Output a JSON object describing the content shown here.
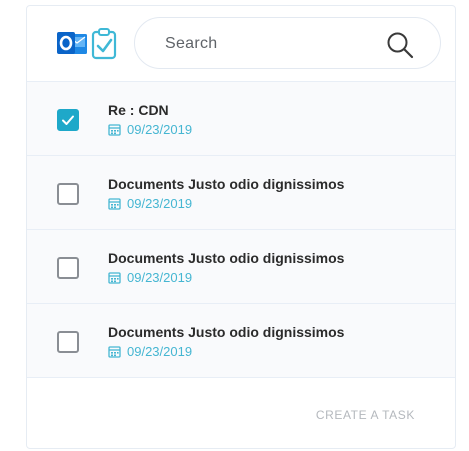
{
  "header": {
    "logo_icon": "outlook-tasks-logo-icon",
    "search": {
      "placeholder": "Search",
      "value": "",
      "icon": "search-icon"
    }
  },
  "tasks": [
    {
      "title": "Re : CDN",
      "date": "09/23/2019",
      "checked": true
    },
    {
      "title": "Documents Justo odio dignissimos",
      "date": "09/23/2019",
      "checked": false
    },
    {
      "title": "Documents Justo odio dignissimos",
      "date": "09/23/2019",
      "checked": false
    },
    {
      "title": "Documents Justo odio dignissimos",
      "date": "09/23/2019",
      "checked": false
    }
  ],
  "footer": {
    "create_task_label": "CREATE A TASK"
  },
  "colors": {
    "accent": "#1ea8c9",
    "date_text": "#45b6d2",
    "outlook_blue": "#0a64c8",
    "muted": "#b4b8bd"
  }
}
